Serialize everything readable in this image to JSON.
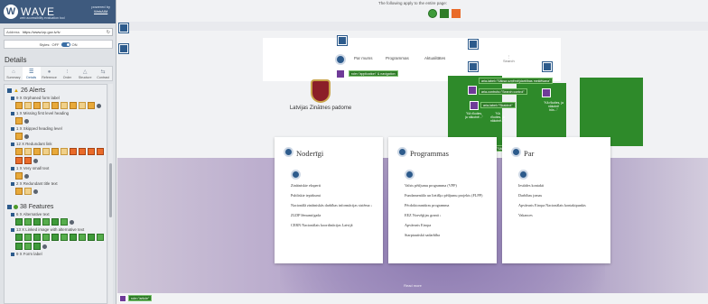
{
  "sidebar": {
    "brand": "WAVE",
    "subtitle": "web accessibility evaluation tool",
    "powered_by": "powered by",
    "powered_link": "WebAIM",
    "address_label": "Address",
    "address_value": "https://www.lzp.gov.lv/lv",
    "styles_label": "Styles:",
    "styles_off": "OFF",
    "styles_on": "ON",
    "details_title": "Details",
    "tabs": [
      "Summary",
      "Details",
      "Reference",
      "Order",
      "Structure",
      "Contrast"
    ],
    "alerts_header": "26 Alerts",
    "alert_items": [
      {
        "label": "9 X Orphaned form label",
        "icons": 9
      },
      {
        "label": "1 X Missing first level heading",
        "icons": 1
      },
      {
        "label": "1 X Skipped heading level",
        "icons": 1
      },
      {
        "label": "12 X Redundant link",
        "icons": 12
      },
      {
        "label": "1 X Very small text",
        "icons": 1
      },
      {
        "label": "2 X Redundant title text",
        "icons": 2
      }
    ],
    "features_header": "38 Features",
    "feature_items": [
      {
        "label": "6 X Alternative text",
        "icons": 6
      },
      {
        "label": "13 X Linked image with alternative text",
        "icons": 13
      },
      {
        "label": "9 X Form label",
        "icons": 0
      }
    ]
  },
  "page": {
    "top_note": "The following apply to the entire page:",
    "nav": [
      "Par mums",
      "Programmas",
      "Aktualitātes"
    ],
    "lang": "Search",
    "org_name": "Latvijas Zinātnes padome",
    "aria_tags": [
      "role=\"application\" & navigation",
      "aria-label=\"Sāksa uzņēmējdarbības meklēšana\"",
      "aria-controls=\"Search control\"",
      "aria-label=\"Skaidrot\"",
      "aria-label=\"Sākam meklēšanu lietošana\"",
      "aria-label=\"Rīki/Statistika\"",
      "role=\"article\""
    ],
    "green_texts": [
      "\"Kā rīkoties, ja nākotnē...\"",
      "\"Kā rīkoties, ja nākotnē...\"",
      "\"Kā rīkoties, ja nākotnē būs...\""
    ],
    "footer_label": "Read more",
    "cards": [
      {
        "title": "Noderīgi",
        "items": [
          "Zinātniskie eksperti",
          "Publiskie iepirkumi",
          "Nacionālā zinātniskās darbības informācijas sistēma ›",
          "ZLDP lēmumi/gada",
          "CERN Nacionālais koordinācijas Latvijā"
        ]
      },
      {
        "title": "Programmas",
        "items": [
          "Valsts pētījumu programma (VPP)",
          "Fundamentālo un lietišķo pētījumu projekts (FLPP)",
          "Pēcdoktorantūras programma",
          "EEZ Norvēģijas granti ›",
          "Apvārsnis Eiropa",
          "Starptautiskā sadarbība"
        ]
      },
      {
        "title": "Par",
        "items": [
          "Iestādes kontakti",
          "Darbības jomas",
          "Apvārsnis Eiropa Nacionālais kontaktpunkts",
          "Vakances"
        ]
      }
    ]
  }
}
